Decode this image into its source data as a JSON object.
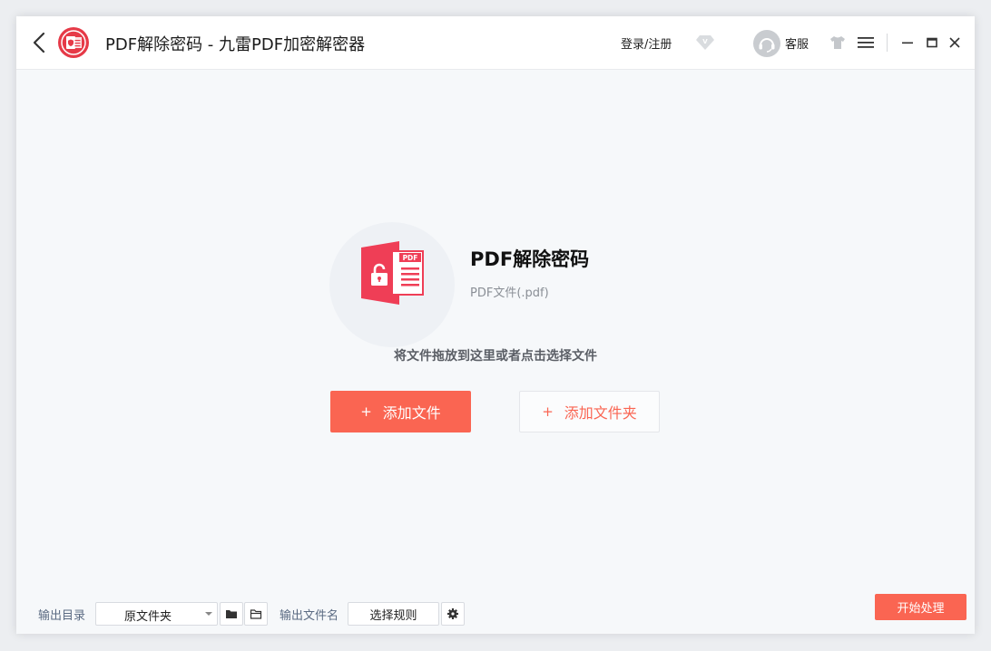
{
  "window": {
    "title": "PDF解除密码 - 九雷PDF加密解密器"
  },
  "header": {
    "login_label": "登录/注册",
    "service_label": "客服",
    "vip_icon": "vip-diamond-icon",
    "skin_icon": "tshirt-icon",
    "menu_icon": "hamburger-menu-icon"
  },
  "feature": {
    "title": "PDF解除密码",
    "subtitle": "PDF文件(.pdf)",
    "icon": "pdf-unlock-icon"
  },
  "drop_hint": "将文件拖放到这里或者点击选择文件",
  "buttons": {
    "add_file": "添加文件",
    "add_folder": "添加文件夹",
    "plus": "+"
  },
  "bottom": {
    "output_dir_label": "输出目录",
    "output_dir_value": "原文件夹",
    "output_name_label": "输出文件名",
    "rule_button": "选择规则",
    "start_button": "开始处理"
  },
  "colors": {
    "accent": "#fa6552",
    "logo": "#e63a48",
    "background": "#f6f8fa"
  }
}
